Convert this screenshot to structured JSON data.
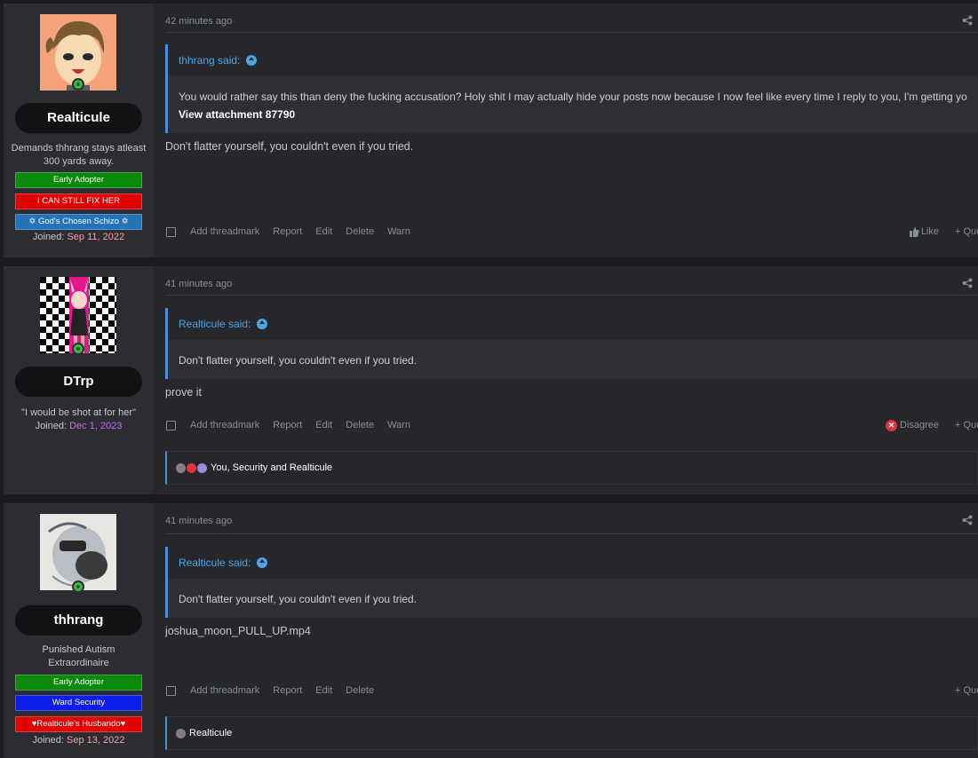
{
  "posts": [
    {
      "user": {
        "name": "Realticule",
        "title": "Demands thhrang stays atleast 300 yards away.",
        "banners": [
          {
            "label": "Early Adopter",
            "color": "#0a8a0a"
          },
          {
            "label": "I CAN STILL FIX HER",
            "color": "#e00000"
          },
          {
            "label": "✡ God's Chosen Schizo ✡",
            "color": "#2473b8"
          }
        ],
        "joined_label": "Joined:",
        "joined_date": "Sep 11, 2022",
        "online": true
      },
      "timestamp": "42 minutes ago",
      "quote": {
        "author": "thhrang said:",
        "text": "You would rather say this than deny the fucking accusation? Holy shit I may actually hide your posts now because I now feel like every time I reply to you, I'm getting you off.",
        "attachment": "View attachment 87790"
      },
      "message": "Don't flatter yourself, you couldn't even if you tried.",
      "actions": [
        "Add threadmark",
        "Report",
        "Edit",
        "Delete",
        "Warn"
      ],
      "like_label": "Like",
      "quote_label": "+ Quote"
    },
    {
      "user": {
        "name": "DTrp",
        "title": "\"I would be shot at for her\"",
        "banners": [],
        "joined_label": "Joined:",
        "joined_date": "Dec 1, 2023",
        "online": true
      },
      "timestamp": "41 minutes ago",
      "quote": {
        "author": "Realticule said:",
        "text": "Don't flatter yourself, you couldn't even if you tried."
      },
      "message": "prove it",
      "actions": [
        "Add threadmark",
        "Report",
        "Edit",
        "Delete",
        "Warn"
      ],
      "disagree_label": "Disagree",
      "quote_label": "+ Quote",
      "reactions_text": "You, Security and Realticule"
    },
    {
      "user": {
        "name": "thhrang",
        "title": "Punished Autism Extraordinaire",
        "banners": [
          {
            "label": "Early Adopter",
            "color": "#0a8a0a"
          },
          {
            "label": "Ward Security",
            "color": "#0a1ee8"
          },
          {
            "label": "♥Realticule's Husbando♥",
            "color": "#e00000"
          }
        ],
        "joined_label": "Joined:",
        "joined_date": "Sep 13, 2022",
        "online": true
      },
      "timestamp": "41 minutes ago",
      "quote": {
        "author": "Realticule said:",
        "text": "Don't flatter yourself, you couldn't even if you tried."
      },
      "message": "joshua_moon_PULL_UP.mp4",
      "actions": [
        "Add threadmark",
        "Report",
        "Edit",
        "Delete"
      ],
      "quote_label": "+ Quote",
      "reactions_text": "Realticule"
    }
  ]
}
